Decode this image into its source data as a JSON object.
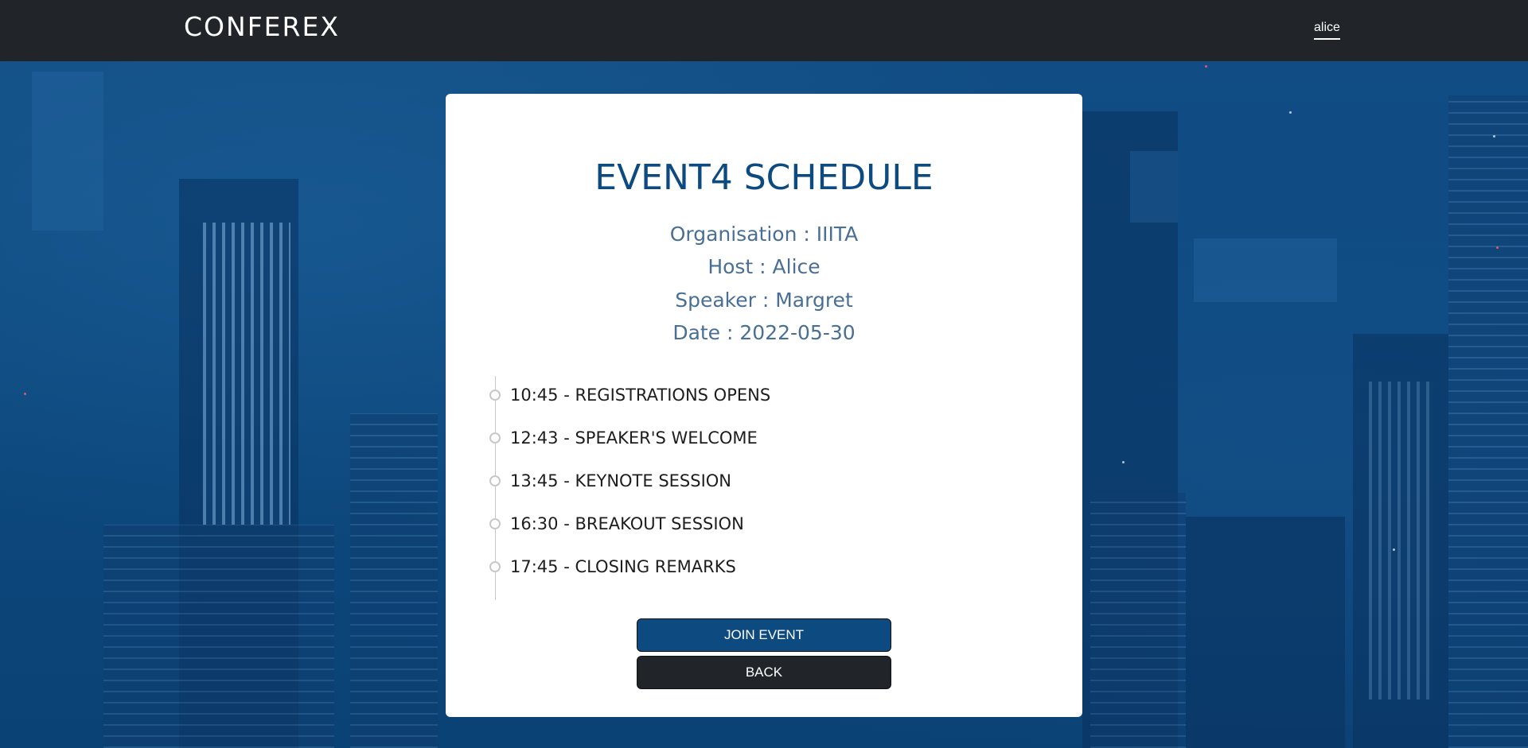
{
  "navbar": {
    "brand": "CONFEREX",
    "user": "alice"
  },
  "event": {
    "title": "EVENT4 SCHEDULE",
    "organisation": "Organisation : IIITA",
    "host": "Host : Alice",
    "speaker": "Speaker : Margret",
    "date": "Date : 2022-05-30"
  },
  "schedule": [
    "10:45 - REGISTRATIONS OPENS",
    "12:43 - SPEAKER'S WELCOME",
    "13:45 - KEYNOTE SESSION",
    "16:30 - BREAKOUT SESSION",
    "17:45 - CLOSING REMARKS"
  ],
  "actions": {
    "join_label": "JOIN EVENT",
    "back_label": "BACK"
  },
  "colors": {
    "navbar": "#212529",
    "accent": "#0d4a80",
    "meta_text": "#4a6f94",
    "background": "#0d4a80"
  }
}
